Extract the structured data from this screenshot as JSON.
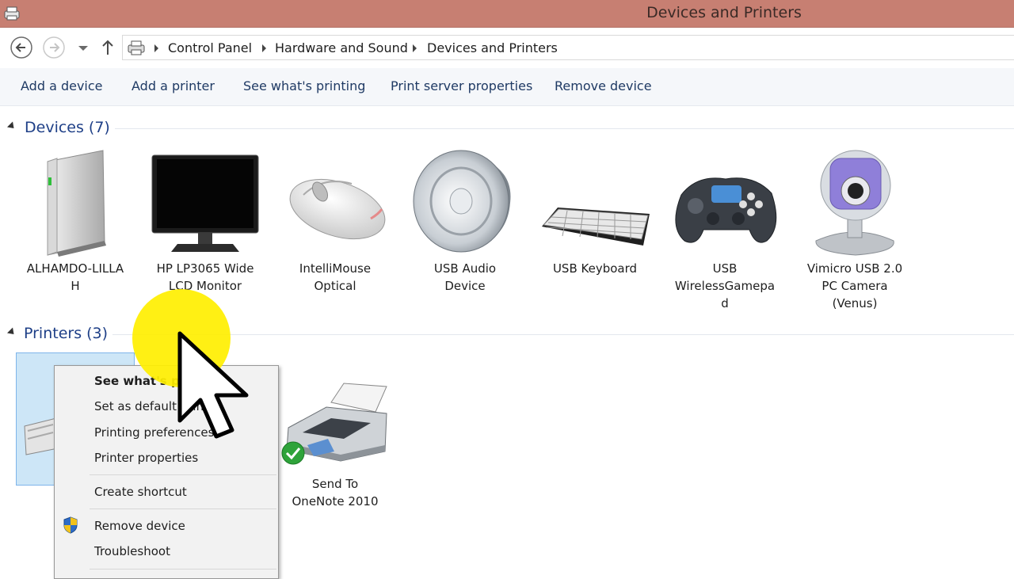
{
  "window": {
    "title": "Devices and Printers"
  },
  "breadcrumb": [
    "Control Panel",
    "Hardware and Sound",
    "Devices and Printers"
  ],
  "toolbar": {
    "add_device": "Add a device",
    "add_printer": "Add a printer",
    "see_printing": "See what's printing",
    "print_server": "Print server properties",
    "remove_device": "Remove device"
  },
  "groups": {
    "devices": "Devices (7)",
    "printers": "Printers (3)"
  },
  "devices": [
    {
      "label": "ALHAMDO-LILLA\nH",
      "icon": "computer-tower-icon"
    },
    {
      "label": "HP LP3065 Wide\nLCD Monitor",
      "icon": "monitor-icon"
    },
    {
      "label": "IntelliMouse\nOptical",
      "icon": "mouse-icon"
    },
    {
      "label": "USB Audio\nDevice",
      "icon": "speaker-icon"
    },
    {
      "label": "USB Keyboard",
      "icon": "keyboard-icon"
    },
    {
      "label": "USB\nWirelessGamepa\nd",
      "icon": "gamepad-icon"
    },
    {
      "label": "Vimicro USB 2.0\nPC Camera\n(Venus)",
      "icon": "webcam-icon"
    }
  ],
  "printers": [
    {
      "label": "Send To\nOneNote 2010",
      "icon": "printer-icon",
      "status": "default"
    }
  ],
  "context_menu": {
    "items": [
      {
        "label": "See what's printing",
        "bold": true
      },
      {
        "label": "Set as default printer"
      },
      {
        "label": "Printing preferences"
      },
      {
        "label": "Printer properties"
      },
      {
        "label": "Create shortcut"
      },
      {
        "label": "Remove device"
      },
      {
        "label": "Troubleshoot"
      }
    ]
  },
  "colors": {
    "titlebar": "#c77f72",
    "group_header": "#1e3f87",
    "cursor_highlight": "#ffef00"
  }
}
